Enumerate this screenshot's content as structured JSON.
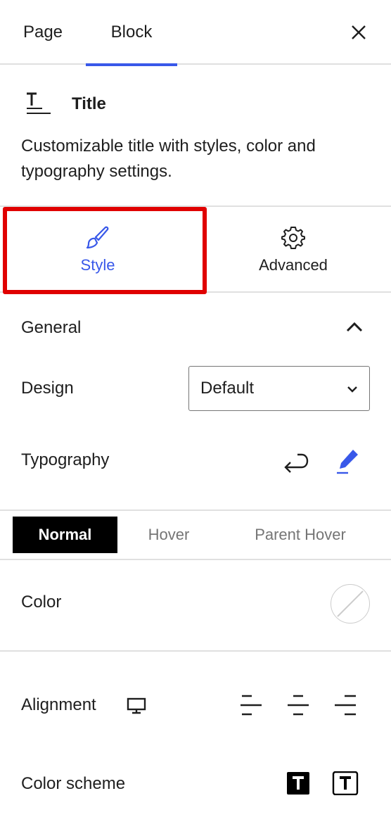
{
  "tabs": {
    "page_label": "Page",
    "block_label": "Block",
    "active": "Block"
  },
  "block": {
    "title": "Title",
    "description": "Customizable title with styles, color and typography settings."
  },
  "inspector_tabs": {
    "style_label": "Style",
    "advanced_label": "Advanced",
    "active": "Style"
  },
  "general": {
    "title": "General",
    "design_label": "Design",
    "design_value": "Default",
    "typography_label": "Typography"
  },
  "state_tabs": {
    "normal": "Normal",
    "hover": "Hover",
    "parent_hover": "Parent Hover",
    "active": "Normal"
  },
  "color": {
    "label": "Color"
  },
  "alignment": {
    "label": "Alignment"
  },
  "color_scheme": {
    "label": "Color scheme"
  },
  "colors": {
    "accent": "#3858e9",
    "highlight_border": "#e00000",
    "divider": "#e0e0e0"
  }
}
